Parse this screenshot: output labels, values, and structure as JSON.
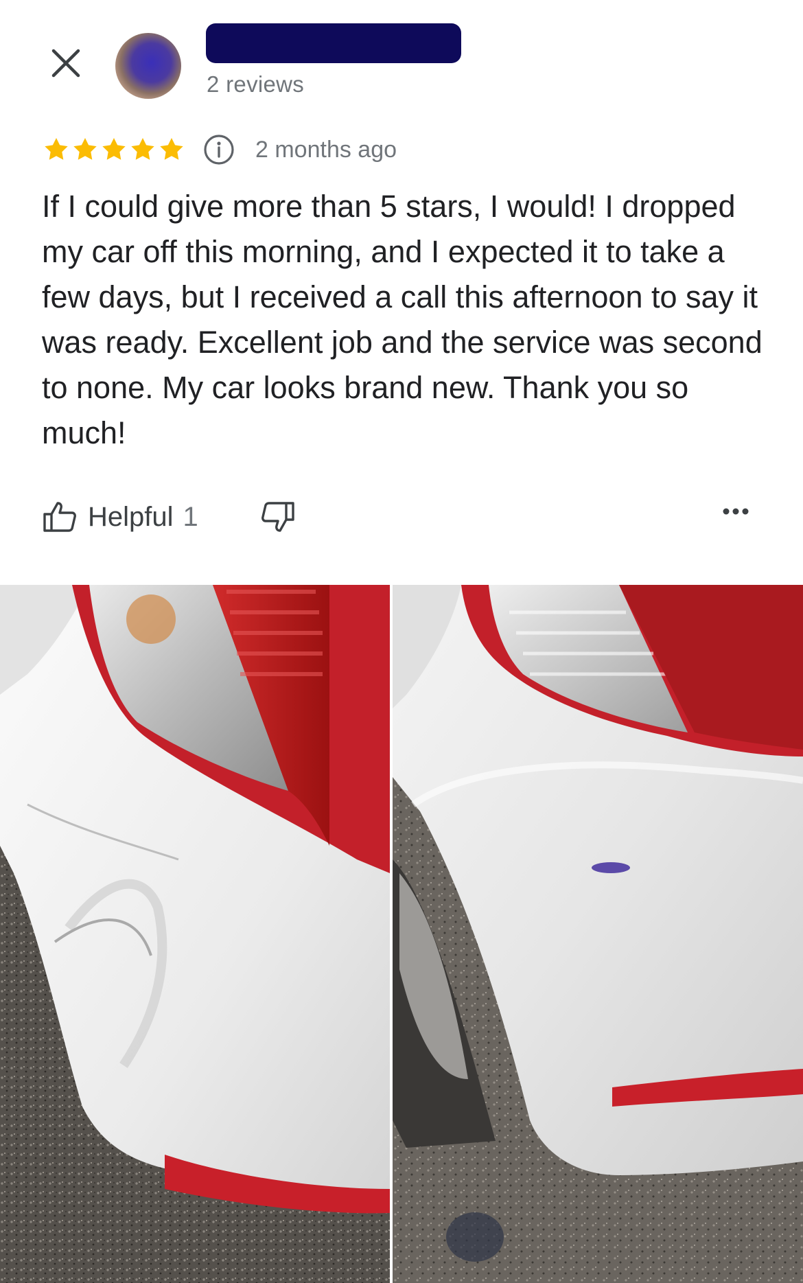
{
  "review": {
    "reviews_count": "2 reviews",
    "rating": 5,
    "max_rating": 5,
    "time_ago": "2 months ago",
    "text": "If I could give more than 5 stars, I would! I dropped my car off this morning, and I expected it to take a few days, but I received a call this afternoon to say it was ready. Excellent job and the service was second to none. My car looks brand new. Thank you so much!",
    "helpful_label": "Helpful",
    "helpful_count": "1"
  },
  "colors": {
    "star": "#fbbc04",
    "redaction": "#0e0a5a",
    "secondary_text": "#70757a"
  },
  "icons": {
    "close": "close-icon",
    "info": "info-icon",
    "thumbs_up": "thumbs-up-icon",
    "thumbs_down": "thumbs-down-icon",
    "more": "more-horizontal-icon"
  }
}
